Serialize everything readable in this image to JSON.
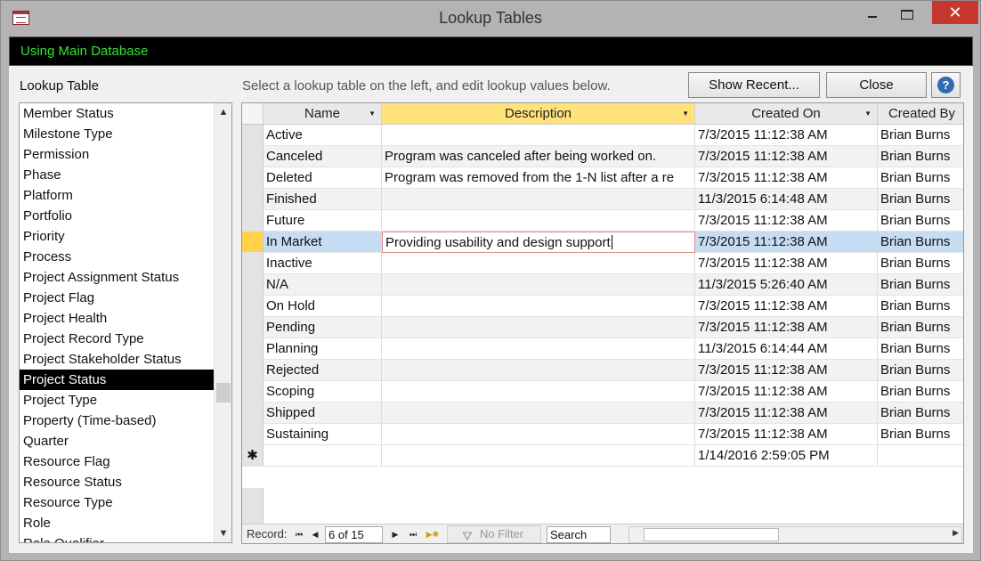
{
  "window": {
    "title": "Lookup Tables",
    "close_glyph": "✕"
  },
  "db_banner": "Using Main Database",
  "lookup_label": "Lookup Table",
  "instructions": "Select a lookup table on the left, and edit lookup values below.",
  "buttons": {
    "show_recent": "Show Recent...",
    "close": "Close",
    "help": "?"
  },
  "colors": {
    "banner_text": "#2ee82e",
    "selected_header": "#ffe27a",
    "current_row": "#c5dcf3",
    "current_selector": "#ffd24a",
    "close_button": "#c7372f"
  },
  "lookup_tables": {
    "selected": "Project Status",
    "items": [
      "Member Status",
      "Milestone Type",
      "Permission",
      "Phase",
      "Platform",
      "Portfolio",
      "Priority",
      "Process",
      "Project Assignment Status",
      "Project Flag",
      "Project Health",
      "Project Record Type",
      "Project Stakeholder Status",
      "Project Status",
      "Project Type",
      "Property (Time-based)",
      "Quarter",
      "Resource Flag",
      "Resource Status",
      "Resource Type",
      "Role",
      "Role Qualifier"
    ]
  },
  "grid": {
    "columns": [
      {
        "key": "name",
        "label": "Name",
        "width": 133
      },
      {
        "key": "description",
        "label": "Description",
        "width": 352,
        "highlighted": true
      },
      {
        "key": "created_on",
        "label": "Created On",
        "width": 205
      },
      {
        "key": "created_by",
        "label": "Created By",
        "width": 100
      }
    ],
    "current_row": 6,
    "editing_column": "description",
    "rows": [
      {
        "name": "Active",
        "description": "",
        "created_on": "7/3/2015 11:12:38 AM",
        "created_by": "Brian Burns"
      },
      {
        "name": "Canceled",
        "description": "Program was canceled after being worked on.",
        "created_on": "7/3/2015 11:12:38 AM",
        "created_by": "Brian Burns"
      },
      {
        "name": "Deleted",
        "description": "Program was removed from the 1-N list after a re",
        "created_on": "7/3/2015 11:12:38 AM",
        "created_by": "Brian Burns"
      },
      {
        "name": "Finished",
        "description": "",
        "created_on": "11/3/2015 6:14:48 AM",
        "created_by": "Brian Burns"
      },
      {
        "name": "Future",
        "description": "",
        "created_on": "7/3/2015 11:12:38 AM",
        "created_by": "Brian Burns"
      },
      {
        "name": "In Market",
        "description": "Providing usability and design support",
        "created_on": "7/3/2015 11:12:38 AM",
        "created_by": "Brian Burns"
      },
      {
        "name": "Inactive",
        "description": "",
        "created_on": "7/3/2015 11:12:38 AM",
        "created_by": "Brian Burns"
      },
      {
        "name": "N/A",
        "description": "",
        "created_on": "11/3/2015 5:26:40 AM",
        "created_by": "Brian Burns"
      },
      {
        "name": "On Hold",
        "description": "",
        "created_on": "7/3/2015 11:12:38 AM",
        "created_by": "Brian Burns"
      },
      {
        "name": "Pending",
        "description": "",
        "created_on": "7/3/2015 11:12:38 AM",
        "created_by": "Brian Burns"
      },
      {
        "name": "Planning",
        "description": "",
        "created_on": "11/3/2015 6:14:44 AM",
        "created_by": "Brian Burns"
      },
      {
        "name": "Rejected",
        "description": "",
        "created_on": "7/3/2015 11:12:38 AM",
        "created_by": "Brian Burns"
      },
      {
        "name": "Scoping",
        "description": "",
        "created_on": "7/3/2015 11:12:38 AM",
        "created_by": "Brian Burns"
      },
      {
        "name": "Shipped",
        "description": "",
        "created_on": "7/3/2015 11:12:38 AM",
        "created_by": "Brian Burns"
      },
      {
        "name": "Sustaining",
        "description": "",
        "created_on": "7/3/2015 11:12:38 AM",
        "created_by": "Brian Burns"
      }
    ],
    "new_row": {
      "marker": "✱",
      "created_on": "1/14/2016 2:59:05 PM"
    }
  },
  "navigation": {
    "record_label": "Record:",
    "record_value": "6 of 15",
    "filter_label": "No Filter",
    "search_placeholder": "Search",
    "first_glyph": "⏮",
    "prev_glyph": "◀",
    "next_glyph": "▶",
    "last_glyph": "⏭",
    "new_glyph": "▶✱"
  },
  "scroll_glyphs": {
    "up": "▲",
    "down": "▼",
    "right": "▶",
    "dropdown": "▼"
  }
}
